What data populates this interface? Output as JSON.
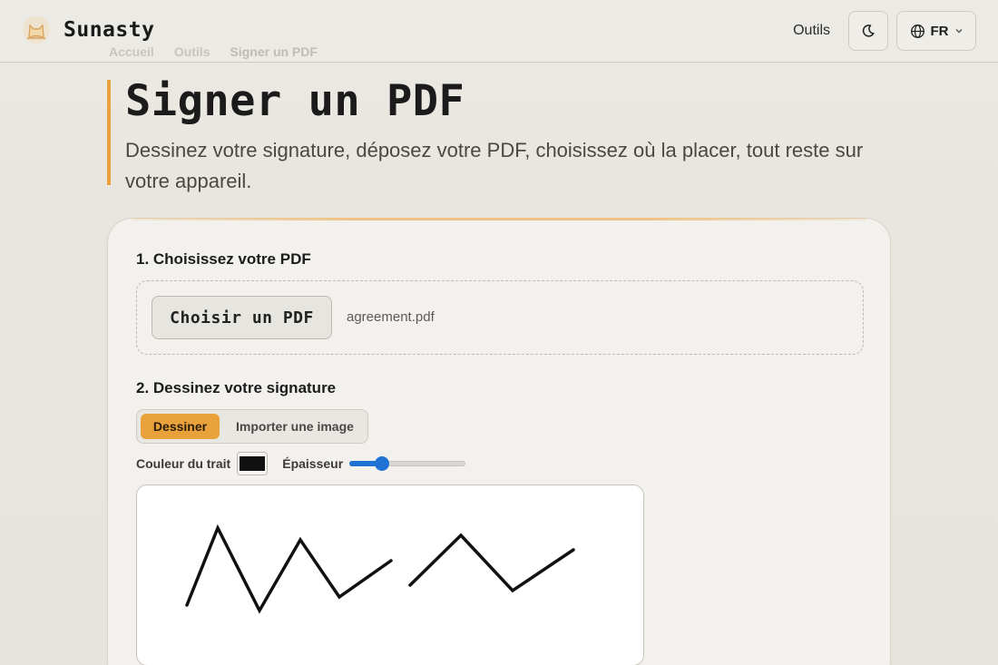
{
  "header": {
    "brand": "Sunasty",
    "nav_tools": "Outils",
    "lang": "FR"
  },
  "breadcrumb": [
    "Accueil",
    "Outils",
    "Signer un PDF"
  ],
  "hero": {
    "title": "Signer un PDF",
    "subtitle": "Dessinez votre signature, déposez votre PDF, choisissez où la placer, tout reste sur votre appareil."
  },
  "step1": {
    "title": "1. Choisissez votre PDF",
    "button": "Choisir un PDF",
    "file_name": "agreement.pdf"
  },
  "step2": {
    "title": "2. Dessinez votre signature",
    "tab_draw": "Dessiner",
    "tab_import": "Importer une image",
    "color_label": "Couleur du trait",
    "stroke_color": "#111111",
    "thickness_label": "Épaisseur",
    "thickness_level": 0.25
  },
  "colors": {
    "accent": "#e9a23b",
    "slider": "#1f72d4"
  },
  "icons": [
    "logo-cat-icon",
    "moon-icon",
    "globe-icon",
    "chevron-down-icon"
  ]
}
